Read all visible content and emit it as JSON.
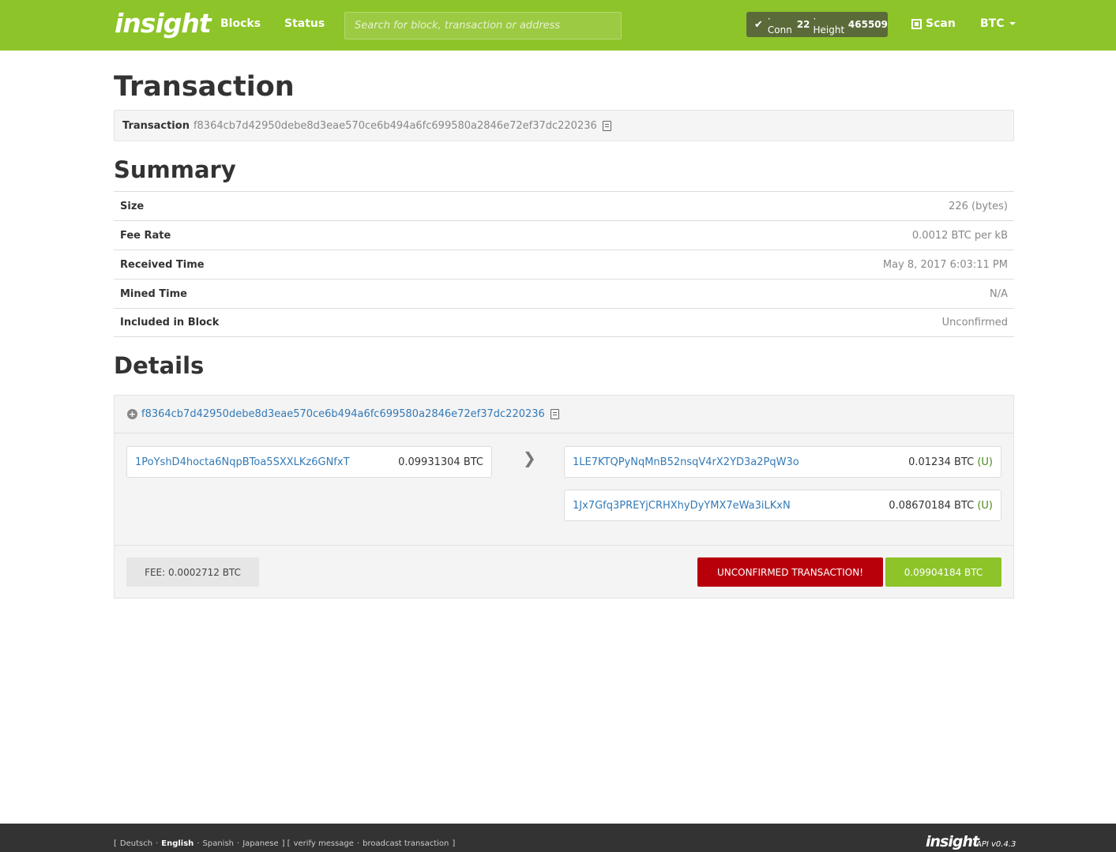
{
  "nav": {
    "logo": "insight",
    "blocks": "Blocks",
    "status": "Status",
    "search_placeholder": "Search for block, transaction or address",
    "conn_prefix": "· Conn",
    "conn_value": "22",
    "height_label": "· Height",
    "height_value": "465509",
    "scan": "Scan",
    "currency": "BTC"
  },
  "transaction": {
    "heading": "Transaction",
    "label": "Transaction",
    "txid": "f8364cb7d42950debe8d3eae570ce6b494a6fc699580a2846e72ef37dc220236"
  },
  "summary": {
    "heading": "Summary",
    "rows": [
      {
        "key": "Size",
        "value": "226 (bytes)"
      },
      {
        "key": "Fee Rate",
        "value": "0.0012 BTC per kB"
      },
      {
        "key": "Received Time",
        "value": "May 8, 2017 6:03:11 PM"
      },
      {
        "key": "Mined Time",
        "value": "N/A"
      },
      {
        "key": "Included in Block",
        "value": "Unconfirmed"
      }
    ]
  },
  "details": {
    "heading": "Details",
    "txid": "f8364cb7d42950debe8d3eae570ce6b494a6fc699580a2846e72ef37dc220236",
    "inputs": [
      {
        "address": "1PoYshD4hocta6NqpBToa5SXXLKz6GNfxT",
        "amount": "0.09931304 BTC"
      }
    ],
    "outputs": [
      {
        "address": "1LE7KTQPyNqMnB52nsqV4rX2YD3a2PqW3o",
        "amount": "0.01234 BTC",
        "flag": "(U)"
      },
      {
        "address": "1Jx7Gfq3PREYjCRHXhyDyYMX7eWa3iLKxN",
        "amount": "0.08670184 BTC",
        "flag": "(U)"
      }
    ],
    "fee": "FEE: 0.0002712 BTC",
    "unconfirmed": "UNCONFIRMED TRANSACTION!",
    "total": "0.09904184 BTC"
  },
  "footer": {
    "open": "[",
    "langs": [
      "Deutsch",
      "English",
      "Spanish",
      "Japanese"
    ],
    "sep": "·",
    "close_open": "] [",
    "verify": "verify message",
    "broadcast": "broadcast transaction",
    "close": "]",
    "logo": "insight",
    "api": "API v0.4.3"
  },
  "colors": {
    "brand": "#8dc429",
    "danger": "#b8000b",
    "link": "#337ab7"
  }
}
